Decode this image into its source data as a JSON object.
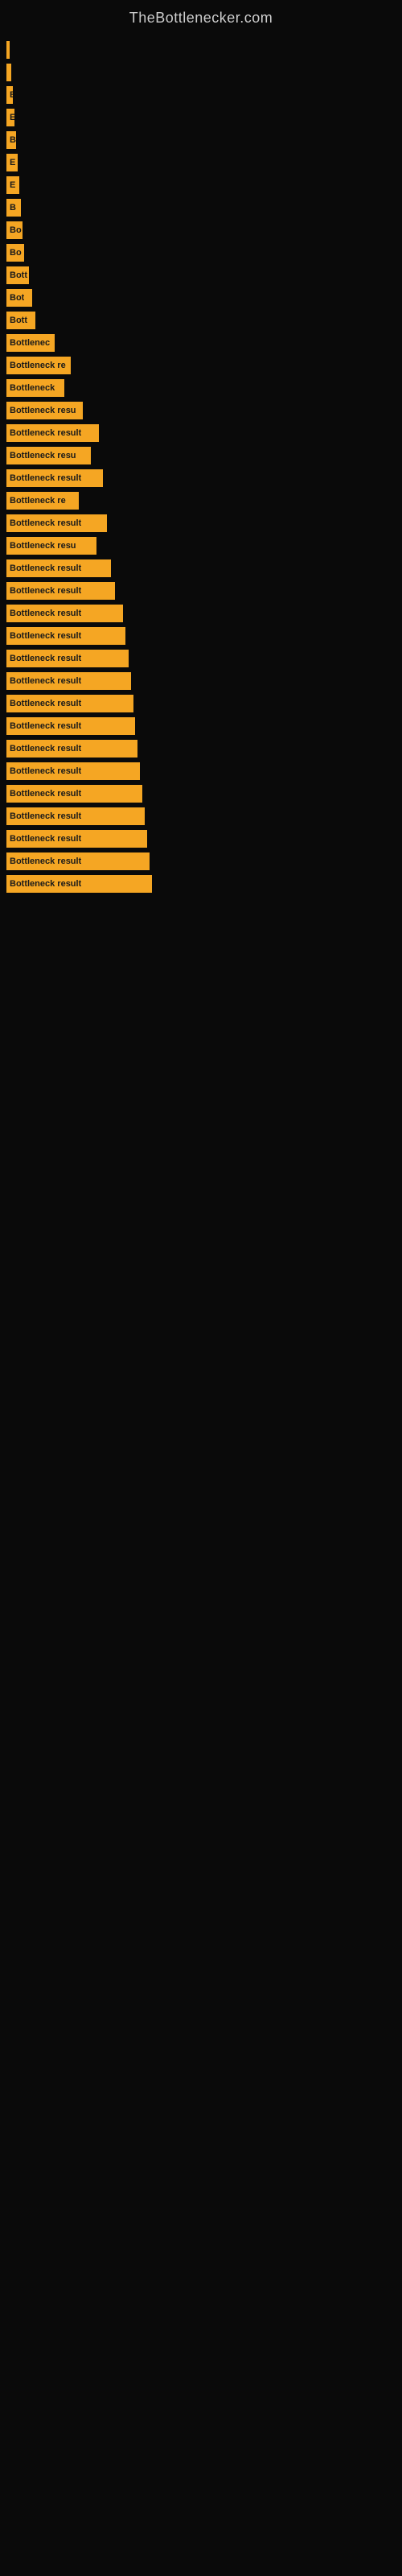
{
  "site": {
    "title": "TheBottlenecker.com"
  },
  "bars": [
    {
      "label": "",
      "width": 4
    },
    {
      "label": "",
      "width": 6
    },
    {
      "label": "E",
      "width": 8
    },
    {
      "label": "E",
      "width": 10
    },
    {
      "label": "B",
      "width": 12
    },
    {
      "label": "E",
      "width": 14
    },
    {
      "label": "E",
      "width": 16
    },
    {
      "label": "B",
      "width": 18
    },
    {
      "label": "Bo",
      "width": 20
    },
    {
      "label": "Bo",
      "width": 22
    },
    {
      "label": "Bott",
      "width": 28
    },
    {
      "label": "Bot",
      "width": 32
    },
    {
      "label": "Bott",
      "width": 36
    },
    {
      "label": "Bottlenec",
      "width": 60
    },
    {
      "label": "Bottleneck re",
      "width": 80
    },
    {
      "label": "Bottleneck",
      "width": 72
    },
    {
      "label": "Bottleneck resu",
      "width": 95
    },
    {
      "label": "Bottleneck result",
      "width": 115
    },
    {
      "label": "Bottleneck resu",
      "width": 105
    },
    {
      "label": "Bottleneck result",
      "width": 120
    },
    {
      "label": "Bottleneck re",
      "width": 90
    },
    {
      "label": "Bottleneck result",
      "width": 125
    },
    {
      "label": "Bottleneck resu",
      "width": 112
    },
    {
      "label": "Bottleneck result",
      "width": 130
    },
    {
      "label": "Bottleneck result",
      "width": 135
    },
    {
      "label": "Bottleneck result",
      "width": 145
    },
    {
      "label": "Bottleneck result",
      "width": 148
    },
    {
      "label": "Bottleneck result",
      "width": 152
    },
    {
      "label": "Bottleneck result",
      "width": 155
    },
    {
      "label": "Bottleneck result",
      "width": 158
    },
    {
      "label": "Bottleneck result",
      "width": 160
    },
    {
      "label": "Bottleneck result",
      "width": 163
    },
    {
      "label": "Bottleneck result",
      "width": 166
    },
    {
      "label": "Bottleneck result",
      "width": 169
    },
    {
      "label": "Bottleneck result",
      "width": 172
    },
    {
      "label": "Bottleneck result",
      "width": 175
    },
    {
      "label": "Bottleneck result",
      "width": 178
    },
    {
      "label": "Bottleneck result",
      "width": 181
    }
  ]
}
